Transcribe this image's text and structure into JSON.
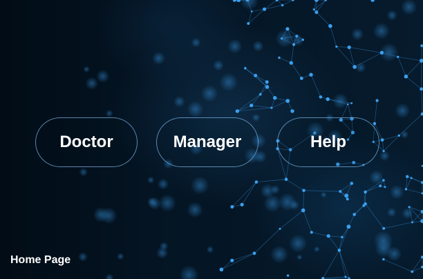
{
  "nav": {
    "doctor_label": "Doctor",
    "manager_label": "Manager",
    "help_label": "Help"
  },
  "footer": {
    "page_label": "Home Page"
  },
  "colors": {
    "background": "#04121f",
    "node": "#2b8fe0",
    "button_border": "#78afe1",
    "text": "#ffffff"
  }
}
